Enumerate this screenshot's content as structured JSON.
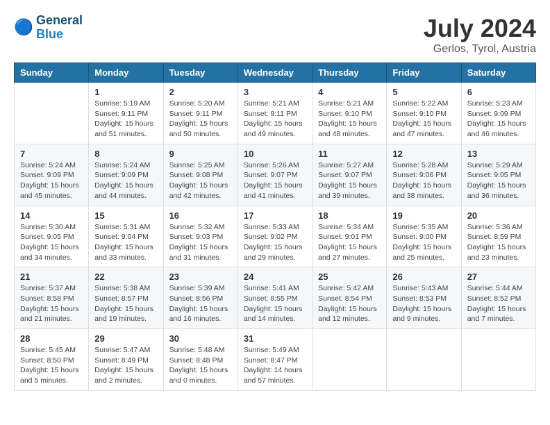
{
  "header": {
    "logo_line1": "General",
    "logo_line2": "Blue",
    "month_year": "July 2024",
    "location": "Gerlos, Tyrol, Austria"
  },
  "weekdays": [
    "Sunday",
    "Monday",
    "Tuesday",
    "Wednesday",
    "Thursday",
    "Friday",
    "Saturday"
  ],
  "weeks": [
    [
      {
        "day": "",
        "info": ""
      },
      {
        "day": "1",
        "info": "Sunrise: 5:19 AM\nSunset: 9:11 PM\nDaylight: 15 hours\nand 51 minutes."
      },
      {
        "day": "2",
        "info": "Sunrise: 5:20 AM\nSunset: 9:11 PM\nDaylight: 15 hours\nand 50 minutes."
      },
      {
        "day": "3",
        "info": "Sunrise: 5:21 AM\nSunset: 9:11 PM\nDaylight: 15 hours\nand 49 minutes."
      },
      {
        "day": "4",
        "info": "Sunrise: 5:21 AM\nSunset: 9:10 PM\nDaylight: 15 hours\nand 48 minutes."
      },
      {
        "day": "5",
        "info": "Sunrise: 5:22 AM\nSunset: 9:10 PM\nDaylight: 15 hours\nand 47 minutes."
      },
      {
        "day": "6",
        "info": "Sunrise: 5:23 AM\nSunset: 9:09 PM\nDaylight: 15 hours\nand 46 minutes."
      }
    ],
    [
      {
        "day": "7",
        "info": "Sunrise: 5:24 AM\nSunset: 9:09 PM\nDaylight: 15 hours\nand 45 minutes."
      },
      {
        "day": "8",
        "info": "Sunrise: 5:24 AM\nSunset: 9:09 PM\nDaylight: 15 hours\nand 44 minutes."
      },
      {
        "day": "9",
        "info": "Sunrise: 5:25 AM\nSunset: 9:08 PM\nDaylight: 15 hours\nand 42 minutes."
      },
      {
        "day": "10",
        "info": "Sunrise: 5:26 AM\nSunset: 9:07 PM\nDaylight: 15 hours\nand 41 minutes."
      },
      {
        "day": "11",
        "info": "Sunrise: 5:27 AM\nSunset: 9:07 PM\nDaylight: 15 hours\nand 39 minutes."
      },
      {
        "day": "12",
        "info": "Sunrise: 5:28 AM\nSunset: 9:06 PM\nDaylight: 15 hours\nand 38 minutes."
      },
      {
        "day": "13",
        "info": "Sunrise: 5:29 AM\nSunset: 9:05 PM\nDaylight: 15 hours\nand 36 minutes."
      }
    ],
    [
      {
        "day": "14",
        "info": "Sunrise: 5:30 AM\nSunset: 9:05 PM\nDaylight: 15 hours\nand 34 minutes."
      },
      {
        "day": "15",
        "info": "Sunrise: 5:31 AM\nSunset: 9:04 PM\nDaylight: 15 hours\nand 33 minutes."
      },
      {
        "day": "16",
        "info": "Sunrise: 5:32 AM\nSunset: 9:03 PM\nDaylight: 15 hours\nand 31 minutes."
      },
      {
        "day": "17",
        "info": "Sunrise: 5:33 AM\nSunset: 9:02 PM\nDaylight: 15 hours\nand 29 minutes."
      },
      {
        "day": "18",
        "info": "Sunrise: 5:34 AM\nSunset: 9:01 PM\nDaylight: 15 hours\nand 27 minutes."
      },
      {
        "day": "19",
        "info": "Sunrise: 5:35 AM\nSunset: 9:00 PM\nDaylight: 15 hours\nand 25 minutes."
      },
      {
        "day": "20",
        "info": "Sunrise: 5:36 AM\nSunset: 8:59 PM\nDaylight: 15 hours\nand 23 minutes."
      }
    ],
    [
      {
        "day": "21",
        "info": "Sunrise: 5:37 AM\nSunset: 8:58 PM\nDaylight: 15 hours\nand 21 minutes."
      },
      {
        "day": "22",
        "info": "Sunrise: 5:38 AM\nSunset: 8:57 PM\nDaylight: 15 hours\nand 19 minutes."
      },
      {
        "day": "23",
        "info": "Sunrise: 5:39 AM\nSunset: 8:56 PM\nDaylight: 15 hours\nand 16 minutes."
      },
      {
        "day": "24",
        "info": "Sunrise: 5:41 AM\nSunset: 8:55 PM\nDaylight: 15 hours\nand 14 minutes."
      },
      {
        "day": "25",
        "info": "Sunrise: 5:42 AM\nSunset: 8:54 PM\nDaylight: 15 hours\nand 12 minutes."
      },
      {
        "day": "26",
        "info": "Sunrise: 5:43 AM\nSunset: 8:53 PM\nDaylight: 15 hours\nand 9 minutes."
      },
      {
        "day": "27",
        "info": "Sunrise: 5:44 AM\nSunset: 8:52 PM\nDaylight: 15 hours\nand 7 minutes."
      }
    ],
    [
      {
        "day": "28",
        "info": "Sunrise: 5:45 AM\nSunset: 8:50 PM\nDaylight: 15 hours\nand 5 minutes."
      },
      {
        "day": "29",
        "info": "Sunrise: 5:47 AM\nSunset: 8:49 PM\nDaylight: 15 hours\nand 2 minutes."
      },
      {
        "day": "30",
        "info": "Sunrise: 5:48 AM\nSunset: 8:48 PM\nDaylight: 15 hours\nand 0 minutes."
      },
      {
        "day": "31",
        "info": "Sunrise: 5:49 AM\nSunset: 8:47 PM\nDaylight: 14 hours\nand 57 minutes."
      },
      {
        "day": "",
        "info": ""
      },
      {
        "day": "",
        "info": ""
      },
      {
        "day": "",
        "info": ""
      }
    ]
  ]
}
